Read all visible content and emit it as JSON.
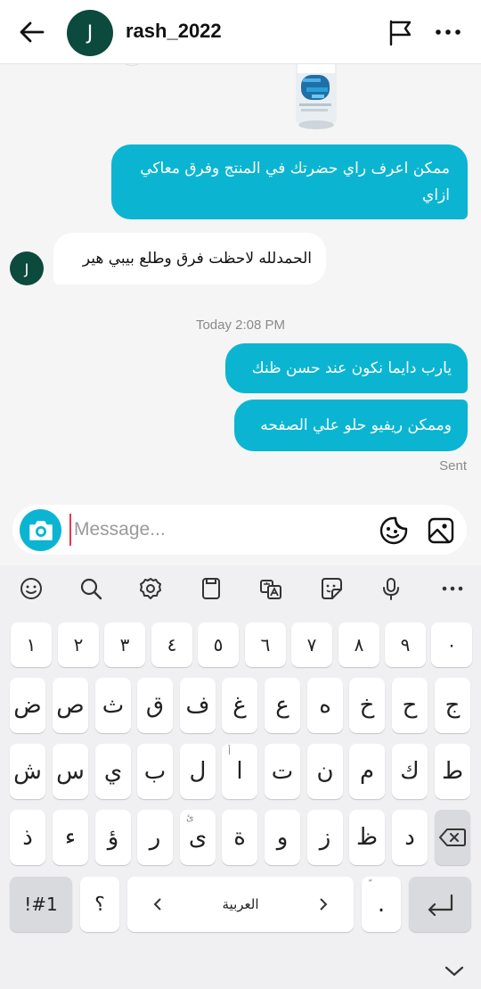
{
  "header": {
    "avatar_letter": "J",
    "username": "rash_2022",
    "icons": [
      "back-arrow-icon",
      "flag-icon",
      "more-horizontal-icon"
    ]
  },
  "chat": {
    "messages": [
      {
        "direction": "outgoing",
        "text": "ممكن اعرف راي حضرتك في المنتج وفرق معاكي ازاي"
      },
      {
        "direction": "incoming",
        "text": "الحمدلله لاحظت فرق وطلع بيبي هير"
      },
      {
        "direction": "outgoing",
        "text": "يارب دايما نكون عند حسن ظنك"
      },
      {
        "direction": "outgoing",
        "text": "وممكن ريفيو حلو علي الصفحه"
      }
    ],
    "incoming_avatar_letter": "J",
    "timestamp": "Today 2:08 PM",
    "status": "Sent",
    "colors": {
      "outgoing_bubble": "#0bb5d2",
      "incoming_bubble": "#ffffff",
      "accent": "#0bb5d2"
    }
  },
  "composer": {
    "placeholder": "Message...",
    "icons": [
      "camera-icon",
      "sticker-icon",
      "gallery-icon"
    ]
  },
  "keyboard": {
    "toolbar_icons": [
      "emoji-icon",
      "search-icon",
      "settings-icon",
      "clipboard-icon",
      "translate-icon",
      "sticker-icon",
      "microphone-icon",
      "more-horizontal-icon"
    ],
    "row_numbers": [
      "١",
      "٢",
      "٣",
      "٤",
      "٥",
      "٦",
      "٧",
      "٨",
      "٩",
      "٠"
    ],
    "row1": [
      "ض",
      "ص",
      "ث",
      "ق",
      "ف",
      "غ",
      "ع",
      "ه",
      "خ",
      "ح",
      "ج"
    ],
    "row2": [
      "ش",
      "س",
      "ي",
      "ب",
      "ل",
      "ا",
      "ت",
      "ن",
      "م",
      "ك",
      "ط"
    ],
    "row2_hint": "أ",
    "row3": [
      "ذ",
      "ء",
      "ؤ",
      "ر",
      "ى",
      "ة",
      "و",
      "ز",
      "ظ",
      "د"
    ],
    "row3_hint": "ئ",
    "symbols_key": "!#1",
    "question_key": "؟",
    "space_label": "العربية",
    "period_key": ".",
    "period_hint": "ّ"
  }
}
